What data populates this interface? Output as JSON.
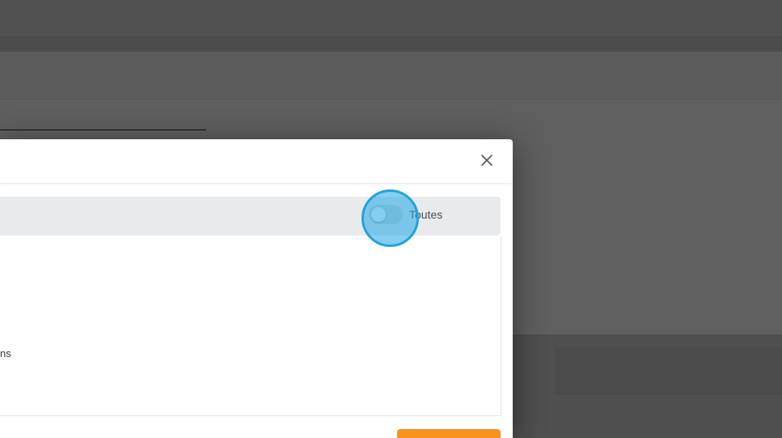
{
  "modal": {
    "toggle_label": "Toutes",
    "toggle_state": "off",
    "content_partial_text": "ns"
  },
  "icons": {
    "close": "close-icon"
  },
  "colors": {
    "overlay": "#5e5e5e",
    "toolbar_bg": "#e8eaec",
    "primary_button": "#f7931e",
    "click_highlight": "#1fa3e0"
  }
}
